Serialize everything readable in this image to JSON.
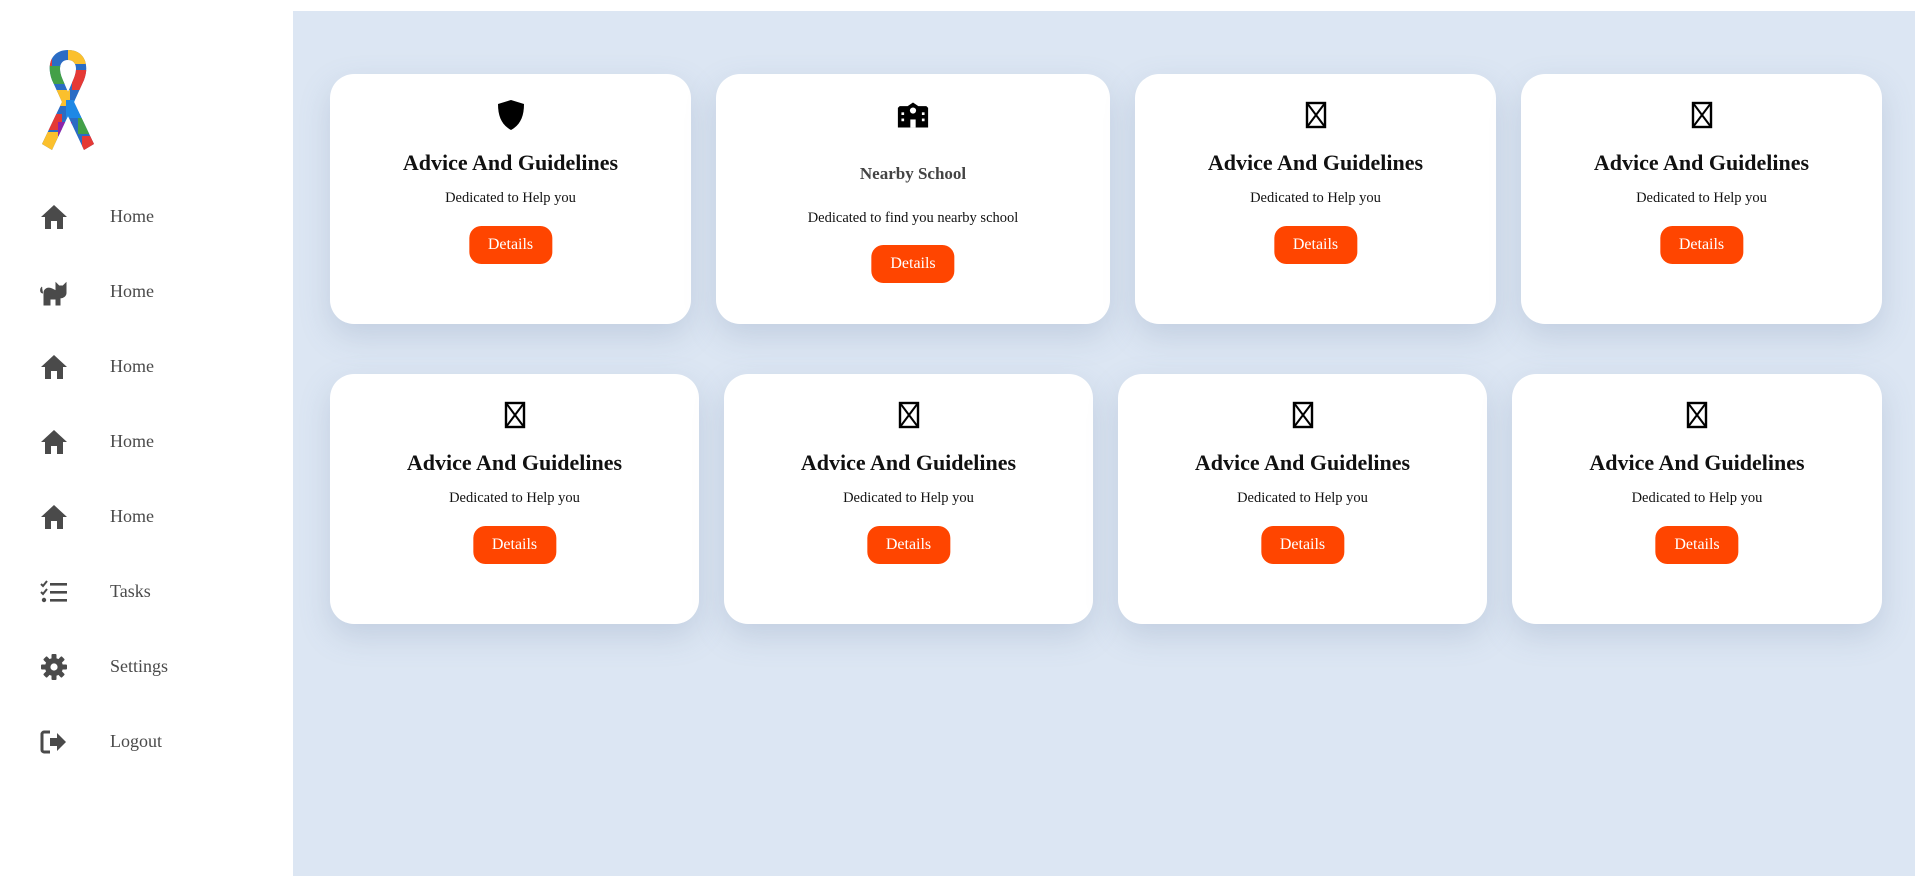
{
  "sidebar": {
    "logo": "autism-awareness-ribbon",
    "items": [
      {
        "label": "Home",
        "icon": "home-icon"
      },
      {
        "label": "Home",
        "icon": "cat-icon"
      },
      {
        "label": "Home",
        "icon": "home-icon"
      },
      {
        "label": "Home",
        "icon": "home-icon"
      },
      {
        "label": "Home",
        "icon": "home-icon"
      },
      {
        "label": "Tasks",
        "icon": "tasks-icon"
      },
      {
        "label": "Settings",
        "icon": "gear-icon"
      },
      {
        "label": "Logout",
        "icon": "logout-icon"
      }
    ]
  },
  "cards": [
    {
      "title": "Advice And Guidelines",
      "subtitle": "Dedicated to Help you",
      "button": "Details",
      "icon": "shield-icon"
    },
    {
      "title": "Nearby School",
      "subtitle": "Dedicated to find you nearby school",
      "button": "Details",
      "icon": "school-icon"
    },
    {
      "title": "Advice And Guidelines",
      "subtitle": "Dedicated to Help you",
      "button": "Details",
      "icon": "missing-glyph-icon"
    },
    {
      "title": "Advice And Guidelines",
      "subtitle": "Dedicated to Help you",
      "button": "Details",
      "icon": "missing-glyph-icon"
    },
    {
      "title": "Advice And Guidelines",
      "subtitle": "Dedicated to Help you",
      "button": "Details",
      "icon": "missing-glyph-icon"
    },
    {
      "title": "Advice And Guidelines",
      "subtitle": "Dedicated to Help you",
      "button": "Details",
      "icon": "missing-glyph-icon"
    },
    {
      "title": "Advice And Guidelines",
      "subtitle": "Dedicated to Help you",
      "button": "Details",
      "icon": "missing-glyph-icon"
    },
    {
      "title": "Advice And Guidelines",
      "subtitle": "Dedicated to Help you",
      "button": "Details",
      "icon": "missing-glyph-icon"
    }
  ],
  "colors": {
    "accent": "#ff4500",
    "main_background": "#dce6f3",
    "nav_icon": "#4a4a4a"
  }
}
